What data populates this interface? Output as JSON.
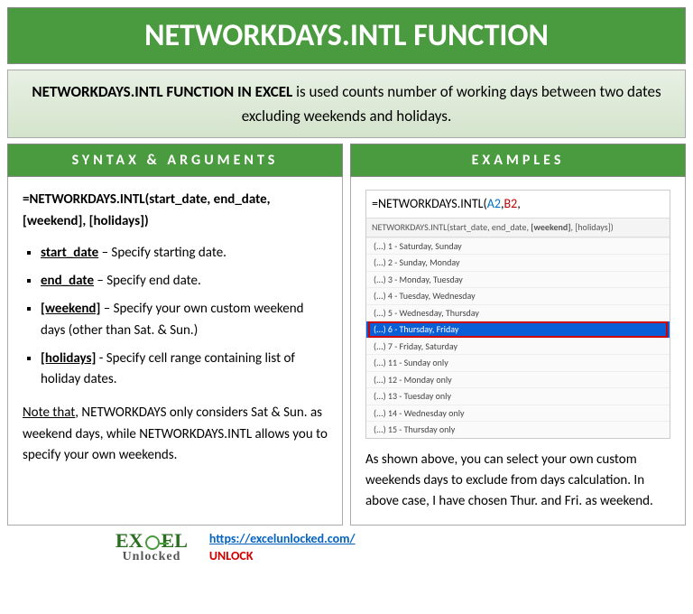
{
  "title": "NETWORKDAYS.INTL FUNCTION",
  "description": {
    "em": "NETWORKDAYS.INTL FUNCTION IN EXCEL",
    "rest": " is used counts number of working days between two dates excluding weekends and holidays."
  },
  "syntax": {
    "header": "SYNTAX & ARGUMENTS",
    "formula": "=NETWORKDAYS.INTL(start_date, end_date, [weekend], [holidays])",
    "args": [
      {
        "name": "start_date",
        "desc": " – Specify starting date."
      },
      {
        "name": "end_date",
        "desc": " – Specify end date."
      },
      {
        "name": "[weekend]",
        "desc": " – Specify your own custom weekend days (other than Sat. & Sun.)"
      },
      {
        "name": "[holidays]",
        "desc": " - Specify cell range containing list of holiday dates."
      }
    ],
    "note_label": "Note that",
    "note": ", NETWORKDAYS only considers Sat & Sun. as weekend days, while NETWORKDAYS.INTL allows you to specify your own weekends."
  },
  "examples": {
    "header": "EXAMPLES",
    "formula_prefix": "=NETWORKDAYS.INTL(",
    "formula_a2": "A2",
    "formula_comma": ",",
    "formula_b2": "B2",
    "formula_trailing": ",",
    "tooltip_plain1": "NETWORKDAYS.INTL(start_date, end_date, ",
    "tooltip_bold": "[weekend]",
    "tooltip_plain2": ", [holidays])",
    "options": [
      "(...) 1 - Saturday, Sunday",
      "(...) 2 - Sunday, Monday",
      "(...) 3 - Monday, Tuesday",
      "(...) 4 - Tuesday, Wednesday",
      "(...) 5 - Wednesday, Thursday",
      "(...) 6 - Thursday, Friday",
      "(...) 7 - Friday, Saturday",
      "(...) 11 - Sunday only",
      "(...) 12 - Monday only",
      "(...) 13 - Tuesday only",
      "(...) 14 - Wednesday only",
      "(...) 15 - Thursday only"
    ],
    "selected_index": 5,
    "desc": "As shown above, you can select your own custom weekends days to exclude from days calculation. In above case, I have chosen Thur. and Fri. as weekend."
  },
  "footer": {
    "logo_top": "EXCEL",
    "logo_bottom": "Unlocked",
    "url": "https://excelunlocked.com/",
    "unlock": "UNLOCK"
  }
}
